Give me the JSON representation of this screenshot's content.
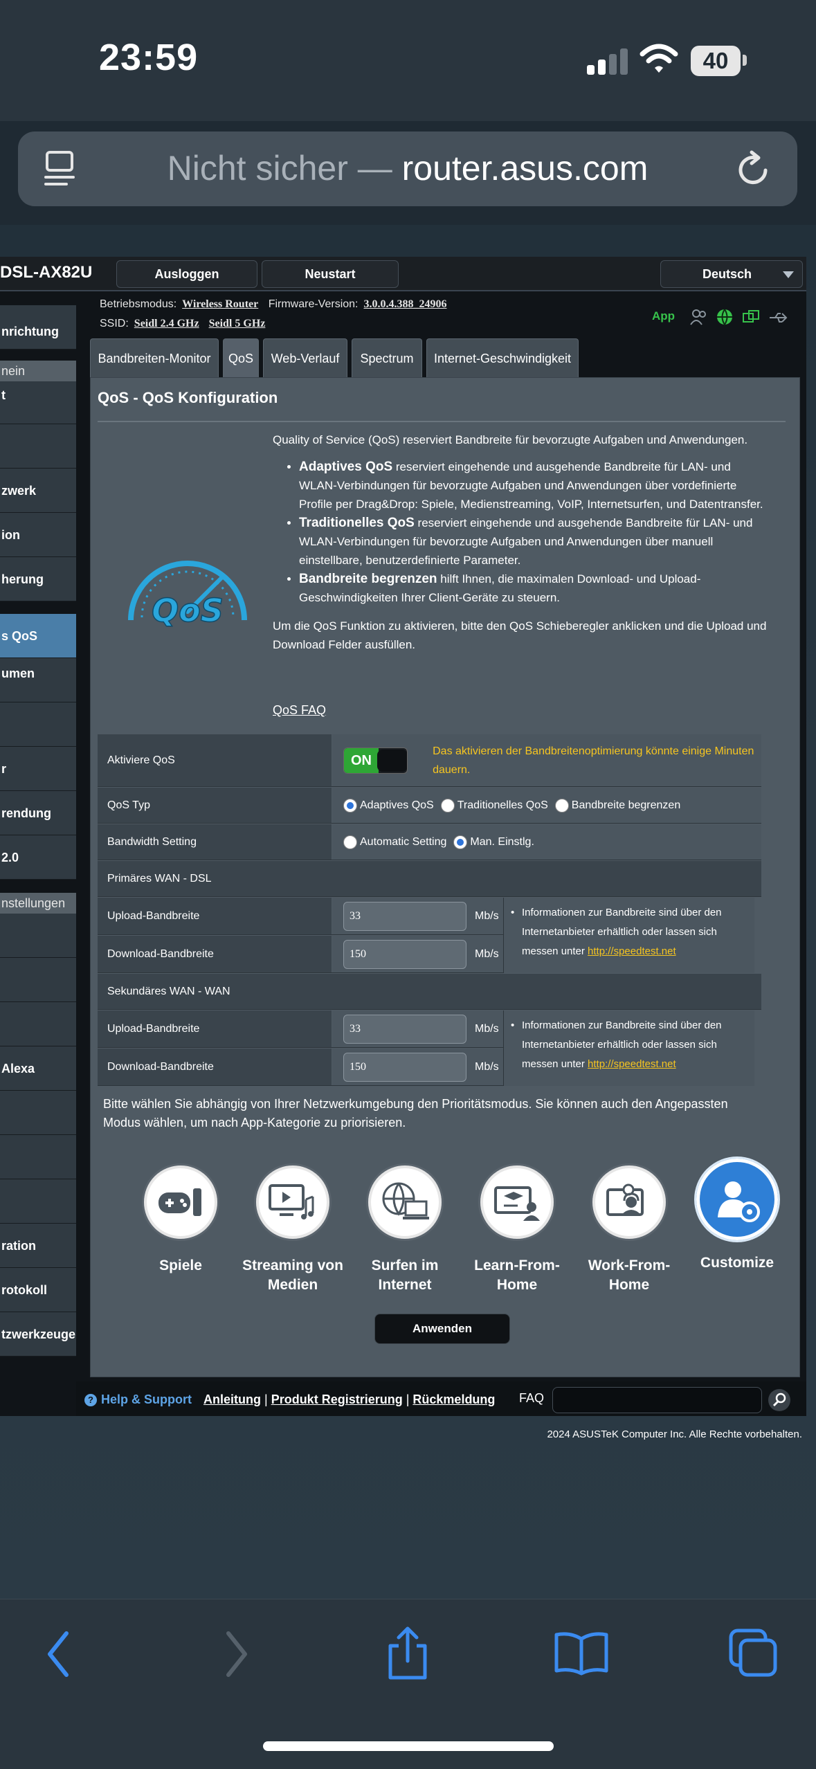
{
  "status_bar": {
    "time": "23:59",
    "battery": "40"
  },
  "url_bar": {
    "insecure_label": "Nicht sicher — ",
    "host": "router.asus.com"
  },
  "router": {
    "model": "DSL-AX82U",
    "logout_label": "Ausloggen",
    "reboot_label": "Neustart",
    "language": "Deutsch",
    "mode_label": "Betriebsmodus:",
    "mode_value": "Wireless Router",
    "firmware_label": "Firmware-Version:",
    "firmware_value": "3.0.0.4.388_24906",
    "ssid_label": "SSID:",
    "ssid_24": "Seidl 2.4 GHz",
    "ssid_5": "Seidl 5 GHz",
    "app_label": "App"
  },
  "sidebar": {
    "items": [
      "nrichtung",
      "nein",
      "t",
      "",
      "zwerk",
      "ion",
      "herung",
      "s QoS",
      "umen",
      "",
      "r",
      "rendung",
      "2.0",
      "nstellungen",
      "",
      "",
      "",
      "Alexa",
      "",
      "",
      "",
      "ration",
      "rotokoll",
      "tzwerkzeuge"
    ]
  },
  "tabs": [
    "Bandbreiten-Monitor",
    "QoS",
    "Web-Verlauf",
    "Spectrum",
    "Internet-Geschwindigkeit"
  ],
  "content": {
    "title": "QoS - QoS Konfiguration",
    "intro": "Quality of Service (QoS) reserviert Bandbreite für bevorzugte Aufgaben und Anwendungen.",
    "bullets": [
      {
        "bold": "Adaptives QoS",
        "text": " reserviert eingehende und ausgehende Bandbreite für LAN- und WLAN-Verbindungen für bevorzugte Aufgaben und Anwendungen über vordefinierte Profile per Drag&Drop: Spiele, Medienstreaming, VoIP, Internetsurfen, und Datentransfer."
      },
      {
        "bold": "Traditionelles QoS",
        "text": " reserviert eingehende und ausgehende Bandbreite für LAN- und WLAN-Verbindungen für bevorzugte Aufgaben und Anwendungen über manuell einstellbare, benutzerdefinierte Parameter."
      },
      {
        "bold": "Bandbreite begrenzen",
        "text": " hilft Ihnen, die maximalen Download- und Upload-Geschwindigkeiten Ihrer Client-Geräte zu steuern."
      }
    ],
    "activate_hint": "Um die QoS Funktion zu aktivieren, bitte den QoS Schieberegler anklicken und die Upload und Download Felder ausfüllen.",
    "faq_link": "QoS FAQ",
    "logo_text": "QoS"
  },
  "settings": {
    "enable_label": "Aktiviere QoS",
    "toggle_on": "ON",
    "enable_warning": "Das aktivieren der Bandbreitenoptimierung könnte einige Minuten dauern.",
    "qos_type_label": "QoS Typ",
    "qos_types": [
      "Adaptives QoS",
      "Traditionelles QoS",
      "Bandbreite begrenzen"
    ],
    "bw_setting_label": "Bandwidth Setting",
    "bw_options": [
      "Automatic Setting",
      "Man. Einstlg."
    ],
    "primary_wan": "Primäres WAN - DSL",
    "secondary_wan": "Sekundäres WAN - WAN",
    "upload_label": "Upload-Bandbreite",
    "download_label": "Download-Bandbreite",
    "primary_upload": "33",
    "primary_download": "150",
    "secondary_upload": "33",
    "secondary_download": "150",
    "unit": "Mb/s",
    "bw_note": "Informationen zur Bandbreite sind über den Internetanbieter erhältlich oder lassen sich messen unter ",
    "bw_link": "http://speedtest.net"
  },
  "priority": {
    "text": "Bitte wählen Sie abhängig von Ihrer Netzwerkumgebung den Prioritätsmodus. Sie können auch den Angepassten Modus wählen, um nach App-Kategorie zu priorisieren.",
    "modes": [
      {
        "line1": "Spiele",
        "line2": ""
      },
      {
        "line1": "Streaming von",
        "line2": "Medien"
      },
      {
        "line1": "Surfen im",
        "line2": "Internet"
      },
      {
        "line1": "Learn-From-",
        "line2": "Home"
      },
      {
        "line1": "Work-From-",
        "line2": "Home"
      },
      {
        "line1": "Customize",
        "line2": ""
      }
    ],
    "apply_label": "Anwenden"
  },
  "footer": {
    "help": "Help & Support",
    "link1": "Anleitung",
    "link2": "Produkt Registrierung",
    "link3": "Rückmeldung",
    "faq": "FAQ",
    "copyright": "2024 ASUSTeK Computer Inc. Alle Rechte vorbehalten."
  }
}
